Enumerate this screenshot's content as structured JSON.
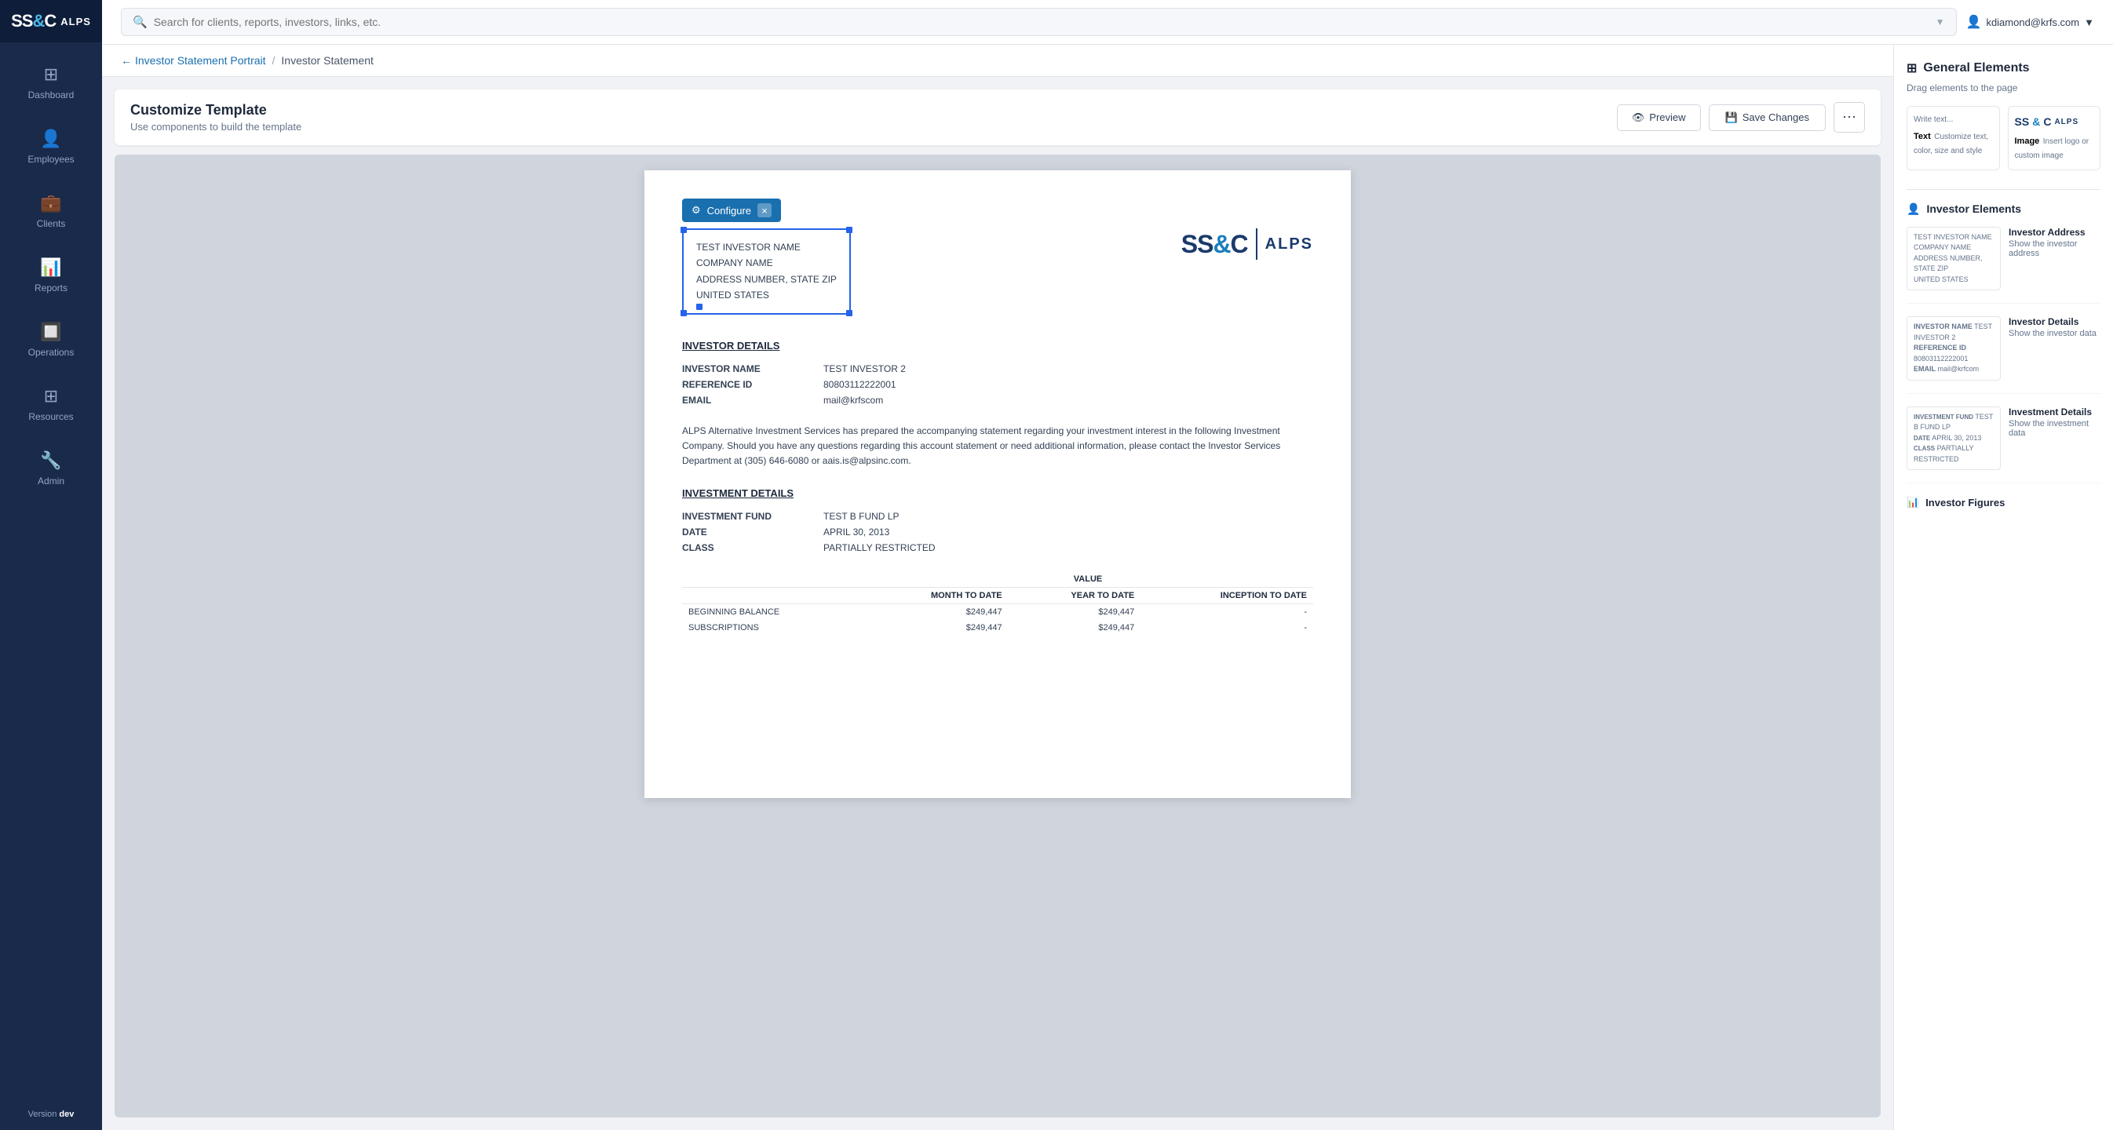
{
  "app": {
    "logo_text": "ss&c",
    "logo_amp": "&",
    "logo_alps": "ALPS",
    "version_label": "Version",
    "version_value": "dev"
  },
  "sidebar": {
    "items": [
      {
        "id": "dashboard",
        "label": "Dashboard",
        "icon": "⊞"
      },
      {
        "id": "employees",
        "label": "Employees",
        "icon": "👤"
      },
      {
        "id": "clients",
        "label": "Clients",
        "icon": "💼"
      },
      {
        "id": "reports",
        "label": "Reports",
        "icon": "📊"
      },
      {
        "id": "operations",
        "label": "Operations",
        "icon": "🔲"
      },
      {
        "id": "resources",
        "label": "Resources",
        "icon": "⊞"
      },
      {
        "id": "admin",
        "label": "Admin",
        "icon": "🔧"
      }
    ]
  },
  "topbar": {
    "search_placeholder": "Search for clients, reports, investors, links, etc.",
    "user_email": "kdiamond@krfs.com"
  },
  "breadcrumb": {
    "back_link": "Investor Statement Portrait",
    "current": "Investor Statement"
  },
  "editor": {
    "title": "Customize Template",
    "subtitle": "Use components to build the template",
    "preview_label": "Preview",
    "save_label": "Save Changes",
    "more_label": "⋯"
  },
  "configure_toolbar": {
    "label": "Configure",
    "close": "×"
  },
  "document": {
    "address_lines": [
      "TEST INVESTOR NAME",
      "COMPANY NAME",
      "ADDRESS NUMBER, STATE ZIP",
      "UNITED STATES"
    ],
    "investor_details_heading": "INVESTOR DETAILS",
    "investor_details": [
      {
        "label": "INVESTOR NAME",
        "value": "TEST INVESTOR 2"
      },
      {
        "label": "REFERENCE ID",
        "value": "80803112222001"
      },
      {
        "label": "EMAIL",
        "value": "mail@krfscom"
      }
    ],
    "statement_text": "ALPS Alternative Investment Services has prepared the accompanying statement regarding your investment interest in the following Investment Company. Should you have any questions regarding this account statement or need additional information, please contact the Investor Services Department at (305) 646-6080 or aais.is@alpsinc.com.",
    "investment_details_heading": "INVESTMENT DETAILS",
    "investment_details": [
      {
        "label": "INVESTMENT FUND",
        "value": "TEST B FUND LP"
      },
      {
        "label": "DATE",
        "value": "APRIL 30, 2013"
      },
      {
        "label": "CLASS",
        "value": "PARTIALLY RESTRICTED"
      }
    ],
    "balance_table": {
      "col_value": "VALUE",
      "col_mtd": "MONTH TO DATE",
      "col_ytd": "YEAR TO DATE",
      "col_inception": "INCEPTION TO DATE",
      "rows": [
        {
          "label": "BEGINNING BALANCE",
          "mtd": "$249,447",
          "ytd": "$249,447",
          "inception": "-"
        },
        {
          "label": "SUBSCRIPTIONS",
          "mtd": "$249,447",
          "ytd": "$249,447",
          "inception": "-"
        }
      ]
    }
  },
  "right_sidebar": {
    "general_title": "General Elements",
    "drag_hint": "Drag elements to the page",
    "general_elements": [
      {
        "id": "text",
        "preview": "Write text...",
        "label": "Text",
        "desc": "Customize text, color, size and style"
      },
      {
        "id": "image",
        "label": "Image",
        "desc": "Insert logo or custom image"
      }
    ],
    "investor_title": "Investor Elements",
    "investor_elements": [
      {
        "id": "investor-address",
        "preview_lines": [
          "TEST INVESTOR NAME",
          "COMPANY NAME",
          "ADDRESS NUMBER, STATE ZIP",
          "UNITED STATES"
        ],
        "label": "Investor Address",
        "desc": "Show the investor address"
      },
      {
        "id": "investor-details",
        "preview_labels": [
          "INVESTOR NAME",
          "REFERENCE ID",
          "EMAIL"
        ],
        "preview_values": [
          "TEST INVESTOR 2",
          "80803112222001",
          "mail@krfcom"
        ],
        "label": "Investor Details",
        "desc": "Show the investor data"
      },
      {
        "id": "investment-details",
        "preview_labels": [
          "INVESTMENT FUND",
          "DATE",
          "CLASS"
        ],
        "preview_values": [
          "TEST B FUND LP",
          "APRIL 30, 2013",
          "PARTIALLY RESTRICTED"
        ],
        "label": "Investment Details",
        "desc": "Show the investment data"
      }
    ],
    "investor_figures_label": "Investor Figures"
  }
}
